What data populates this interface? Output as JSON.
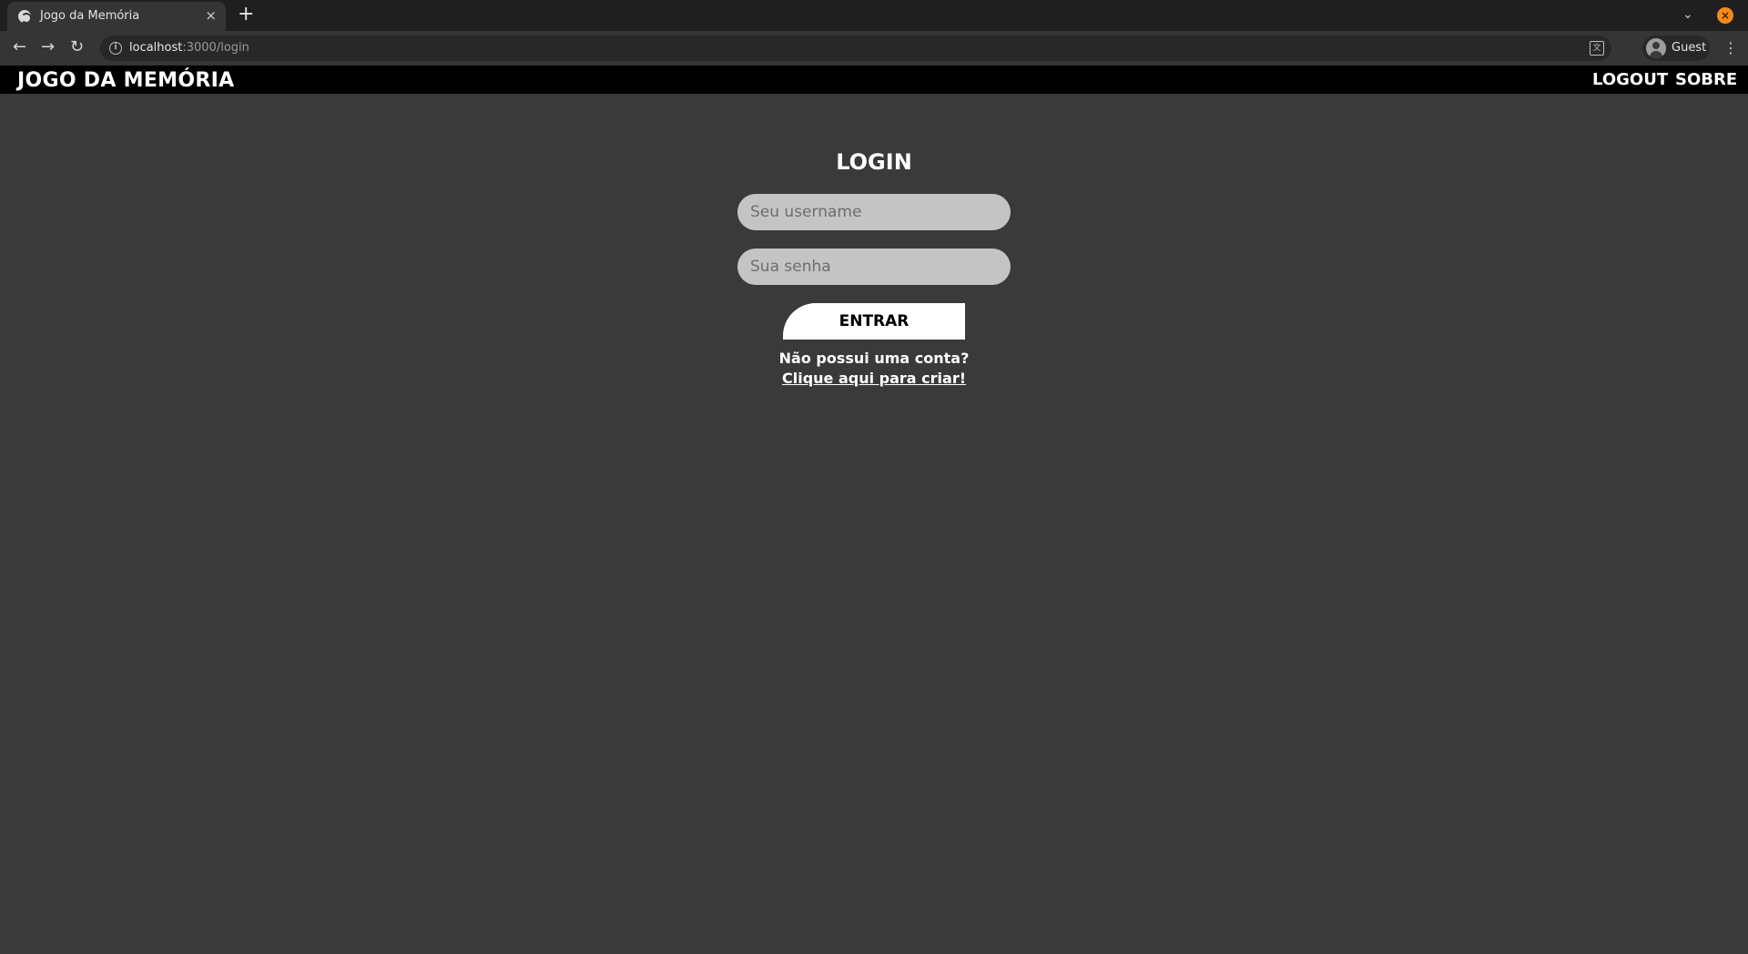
{
  "browser": {
    "tab_title": "Jogo da Memória",
    "tab_close": "×",
    "new_tab": "+",
    "url_host": "localhost",
    "url_path": ":3000/login",
    "profile_name": "Guest",
    "icons": {
      "back": "←",
      "forward": "→",
      "reload": "↻",
      "tab_search": "⌄",
      "window_close": "×",
      "menu": "⋮",
      "info": "i",
      "translate": "文"
    }
  },
  "header": {
    "brand": "JOGO DA MEMÓRIA",
    "nav": [
      "LOGOUT",
      "SOBRE"
    ],
    "background": "#000000"
  },
  "login": {
    "title": "LOGIN",
    "username_placeholder": "Seu username",
    "password_placeholder": "Sua senha",
    "submit_label": "ENTRAR",
    "signup_prompt": "Não possui uma conta?",
    "signup_link": "Clique aqui para criar!"
  },
  "colors": {
    "page_bg": "#3a3a3a",
    "input_bg": "#c4c4c4",
    "button_bg": "#ffffff",
    "window_close": "#f28b1b"
  }
}
